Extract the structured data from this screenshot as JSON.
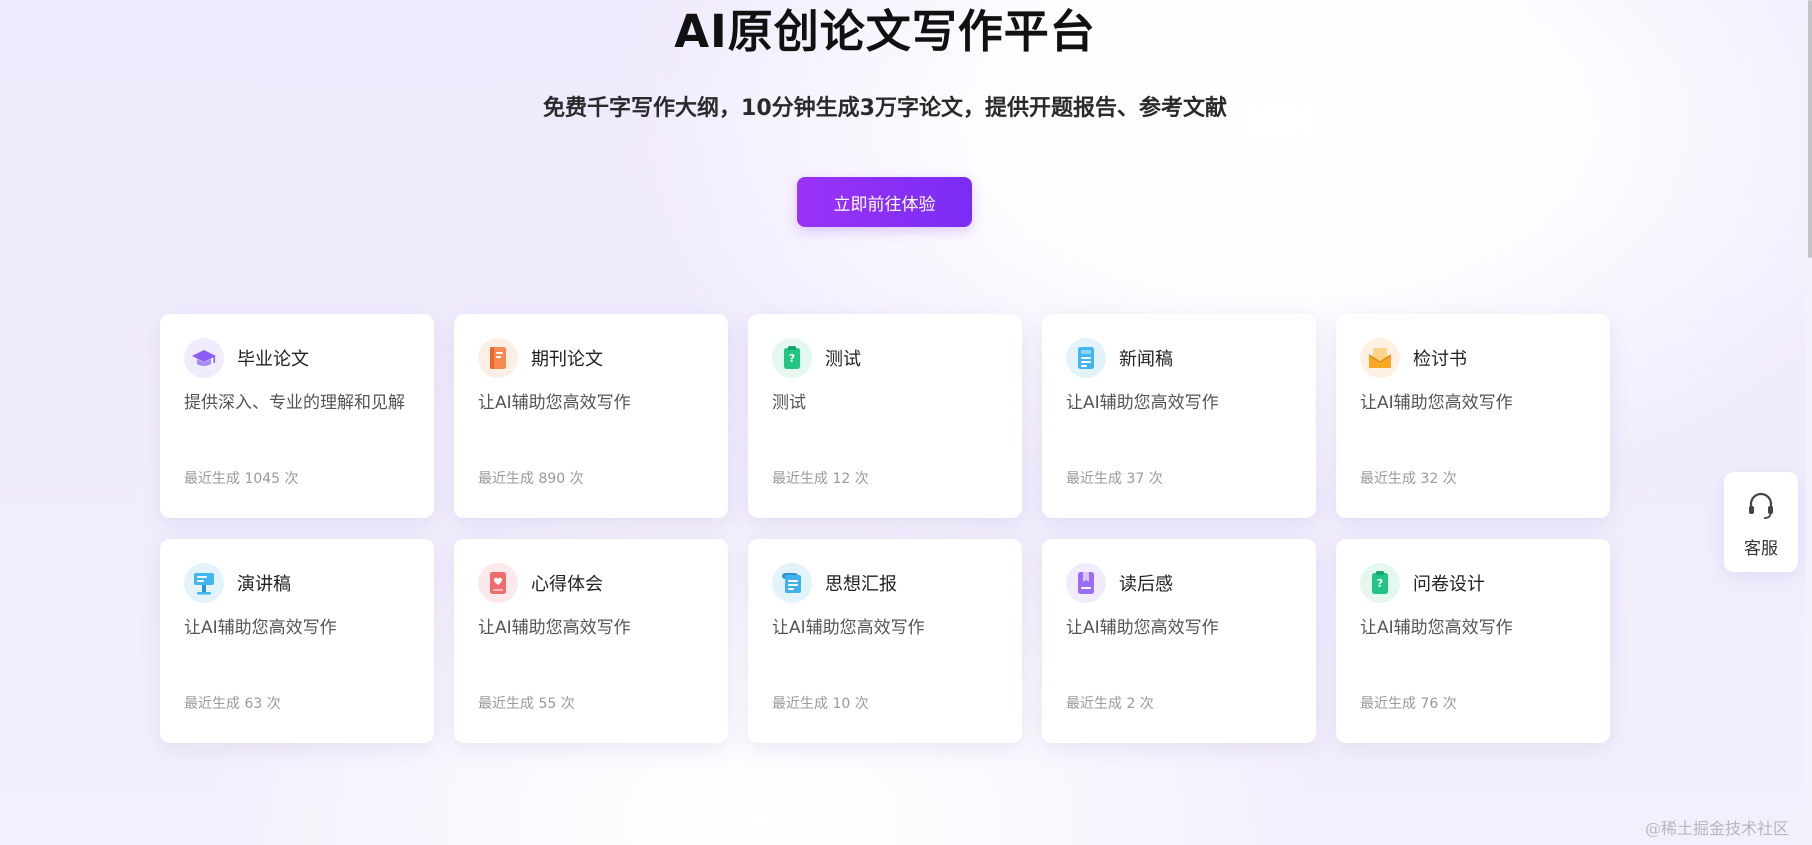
{
  "hero": {
    "title": "AI原创论文写作平台",
    "subtitle": "免费千字写作大纲，10分钟生成3万字论文，提供开题报告、参考文献",
    "cta_label": "立即前往体验"
  },
  "cards": [
    {
      "title": "毕业论文",
      "desc": "提供深入、专业的理解和见解",
      "stat": "最近生成 1045 次",
      "icon": "graduation-cap-icon",
      "color": "#8b5cf6",
      "bg": "#f1ebfe"
    },
    {
      "title": "期刊论文",
      "desc": "让AI辅助您高效写作",
      "stat": "最近生成 890 次",
      "icon": "journal-book-icon",
      "color": "#f7884f",
      "bg": "#fdeee6"
    },
    {
      "title": "测试",
      "desc": "测试",
      "stat": "最近生成 12 次",
      "icon": "test-doc-icon",
      "color": "#22c584",
      "bg": "#e4f8ef"
    },
    {
      "title": "新闻稿",
      "desc": "让AI辅助您高效写作",
      "stat": "最近生成 37 次",
      "icon": "news-doc-icon",
      "color": "#42b4f0",
      "bg": "#e3f3fc"
    },
    {
      "title": "检讨书",
      "desc": "让AI辅助您高效写作",
      "stat": "最近生成 32 次",
      "icon": "envelope-icon",
      "color": "#f9a826",
      "bg": "#fdf2e1"
    },
    {
      "title": "演讲稿",
      "desc": "让AI辅助您高效写作",
      "stat": "最近生成 63 次",
      "icon": "podium-icon",
      "color": "#40b6ef",
      "bg": "#e3f3fc"
    },
    {
      "title": "心得体会",
      "desc": "让AI辅助您高效写作",
      "stat": "最近生成 55 次",
      "icon": "heart-book-icon",
      "color": "#f06b6b",
      "bg": "#fde9e9"
    },
    {
      "title": "思想汇报",
      "desc": "让AI辅助您高效写作",
      "stat": "最近生成 10 次",
      "icon": "scroll-doc-icon",
      "color": "#3fb2ee",
      "bg": "#e3f3fc"
    },
    {
      "title": "读后感",
      "desc": "让AI辅助您高效写作",
      "stat": "最近生成 2 次",
      "icon": "bookmark-book-icon",
      "color": "#9b6cf5",
      "bg": "#f1ebfe"
    },
    {
      "title": "问卷设计",
      "desc": "让AI辅助您高效写作",
      "stat": "最近生成 76 次",
      "icon": "questionnaire-icon",
      "color": "#22c584",
      "bg": "#e4f8ef"
    }
  ],
  "service": {
    "label": "客服"
  },
  "watermark": "@稀土掘金技术社区"
}
